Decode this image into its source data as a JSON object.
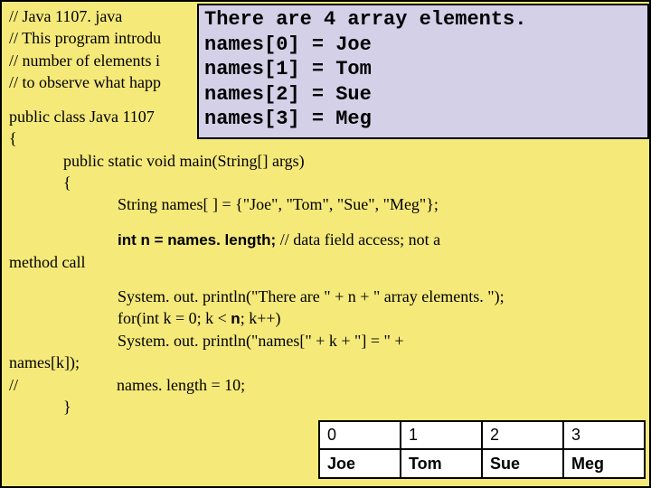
{
  "comments": {
    "c1": "// Java 1107. java",
    "c2": "// This program introdu",
    "c3": "// number of elements i",
    "c4": "// to observe what happ"
  },
  "code": {
    "classDecl": "public class Java 1107",
    "openBrace1": "{",
    "mainDecl": "public static void main(String[] args)",
    "openBrace2": "{",
    "arrayInit": "String names[ ] = {\"Joe\", \"Tom\", \"Sue\", \"Meg\"};",
    "lenLineBold": "int n = names. length;",
    "lenLineComment": "   // data field access; not a",
    "methodCall": "method call",
    "println1": "System. out. println(\"There are \" + n + \" array elements. \");",
    "forLine1": "for(int k = 0; k < ",
    "forLineBold": "n",
    "forLine2": "; k++)",
    "println2": "        System. out. println(\"names[\" + k + \"] = \" +",
    "namesK": "names[k]);",
    "slashes": "//",
    "lenAssign": "names. length = 10;",
    "closeBrace2": "}"
  },
  "output": {
    "l1": "There are 4 array elements.",
    "l2": "names[0] = Joe",
    "l3": "names[1] = Tom",
    "l4": "names[2] = Sue",
    "l5": "names[3] = Meg"
  },
  "array": {
    "idx": [
      "0",
      "1",
      "2",
      "3"
    ],
    "val": [
      "Joe",
      "Tom",
      "Sue",
      "Meg"
    ]
  }
}
